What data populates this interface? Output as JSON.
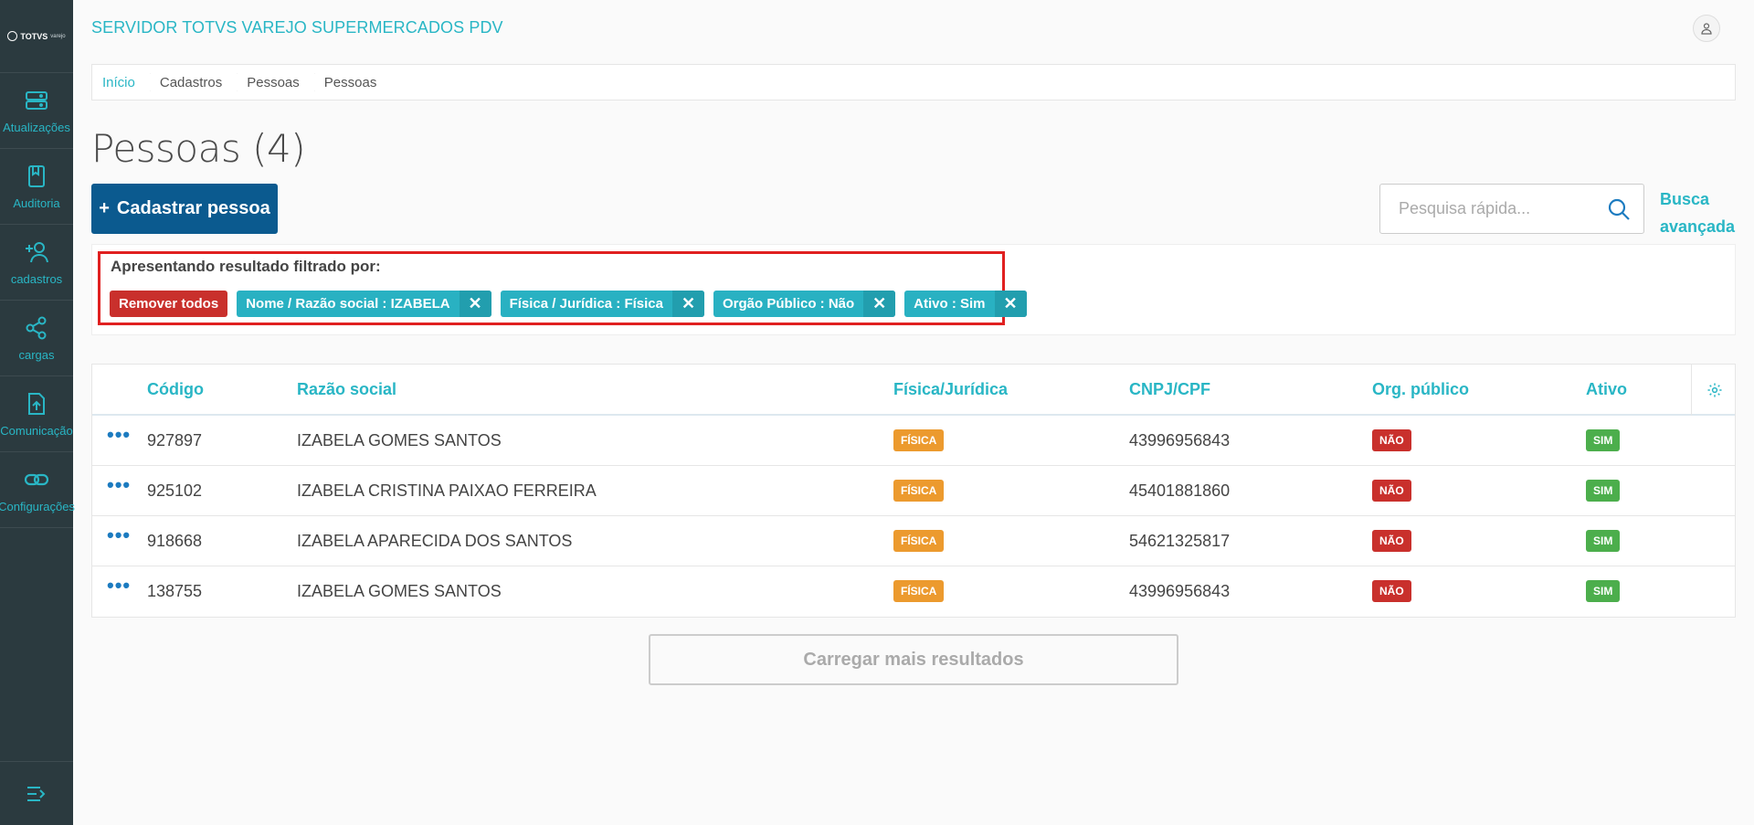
{
  "app": {
    "title": "SERVIDOR TOTVS VAREJO SUPERMERCADOS PDV",
    "logo_text": "TOTVS",
    "logo_sub": "varejo"
  },
  "sidebar": {
    "items": [
      {
        "label": "Atualizações",
        "icon": "server-icon"
      },
      {
        "label": "Auditoria",
        "icon": "bookmark-book-icon"
      },
      {
        "label": "cadastros",
        "icon": "add-user-icon"
      },
      {
        "label": "cargas",
        "icon": "share-icon"
      },
      {
        "label": "Comunicação",
        "icon": "upload-file-icon"
      },
      {
        "label": "Configurações",
        "icon": "link-icon"
      }
    ],
    "toggle_icon": "menu-collapse-icon"
  },
  "breadcrumb": [
    "Início",
    "Cadastros",
    "Pessoas",
    "Pessoas"
  ],
  "page": {
    "title": "Pessoas (4)",
    "add_button": "Cadastrar pessoa",
    "search_placeholder": "Pesquisa rápida...",
    "advanced_search_line1": "Busca",
    "advanced_search_line2": "avançada"
  },
  "filters": {
    "title": "Apresentando resultado filtrado por:",
    "remove_all": "Remover todos",
    "chips": [
      "Nome / Razão social : IZABELA",
      "Física / Jurídica : Física",
      "Orgão Público : Não",
      "Ativo : Sim"
    ]
  },
  "table": {
    "headers": {
      "codigo": "Código",
      "razao": "Razão social",
      "fj": "Física/Jurídica",
      "cnpj": "CNPJ/CPF",
      "org": "Org. público",
      "ativo": "Ativo"
    },
    "rows": [
      {
        "codigo": "927897",
        "razao": "IZABELA GOMES SANTOS",
        "fj": "FÍSICA",
        "cnpj": "43996956843",
        "org": "NÃO",
        "ativo": "SIM"
      },
      {
        "codigo": "925102",
        "razao": "IZABELA CRISTINA PAIXAO FERREIRA",
        "fj": "FÍSICA",
        "cnpj": "45401881860",
        "org": "NÃO",
        "ativo": "SIM"
      },
      {
        "codigo": "918668",
        "razao": "IZABELA APARECIDA DOS SANTOS",
        "fj": "FÍSICA",
        "cnpj": "54621325817",
        "org": "NÃO",
        "ativo": "SIM"
      },
      {
        "codigo": "138755",
        "razao": "IZABELA GOMES SANTOS",
        "fj": "FÍSICA",
        "cnpj": "43996956843",
        "org": "NÃO",
        "ativo": "SIM"
      }
    ]
  },
  "load_more": "Carregar mais resultados",
  "colors": {
    "accent": "#29b6c5",
    "primary": "#0b5a8f",
    "danger": "#c9302c",
    "warning": "#ec9a2e",
    "success": "#4cae4c",
    "sidebar": "#2b3a3f"
  }
}
